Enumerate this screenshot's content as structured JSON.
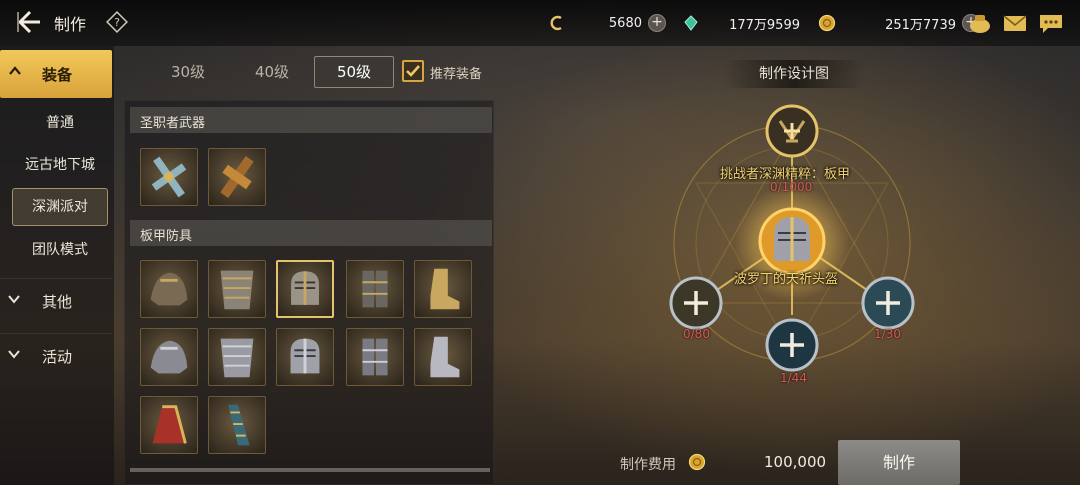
{
  "header": {
    "title": "制作",
    "currencies": [
      {
        "name": "c-coin",
        "value": "5680"
      },
      {
        "name": "green-gem",
        "value": "177万9599"
      },
      {
        "name": "gold-coin",
        "value": "251万7739"
      }
    ]
  },
  "sidebar": {
    "open_category": "装备",
    "sub_items": [
      "普通",
      "远古地下城",
      "深渊派对",
      "团队模式"
    ],
    "selected_sub": "深渊派对",
    "closed_categories": [
      "其他",
      "活动"
    ]
  },
  "level_tabs": [
    "30级",
    "40级",
    "50级"
  ],
  "selected_level": "50级",
  "recommend_label": "推荐装备",
  "recommend_checked": true,
  "sections": [
    {
      "title": "圣职者武器",
      "item_count": 2
    },
    {
      "title": "板甲防具",
      "item_count": 12
    }
  ],
  "design": {
    "heading": "制作设计图",
    "top_material": "挑战者深渊精粹：板甲",
    "top_count": "0/1000",
    "target_item": "波罗丁的天祈头盔",
    "left_count": "0/80",
    "bottom_count": "1/44",
    "right_count": "1/30"
  },
  "footer": {
    "cost_label": "制作费用",
    "cost_value": "100,000",
    "craft_button": "制作"
  },
  "colors": {
    "accent_gold": "#f2c85a",
    "count_red": "#d95555",
    "label_gold": "#f3d270"
  }
}
